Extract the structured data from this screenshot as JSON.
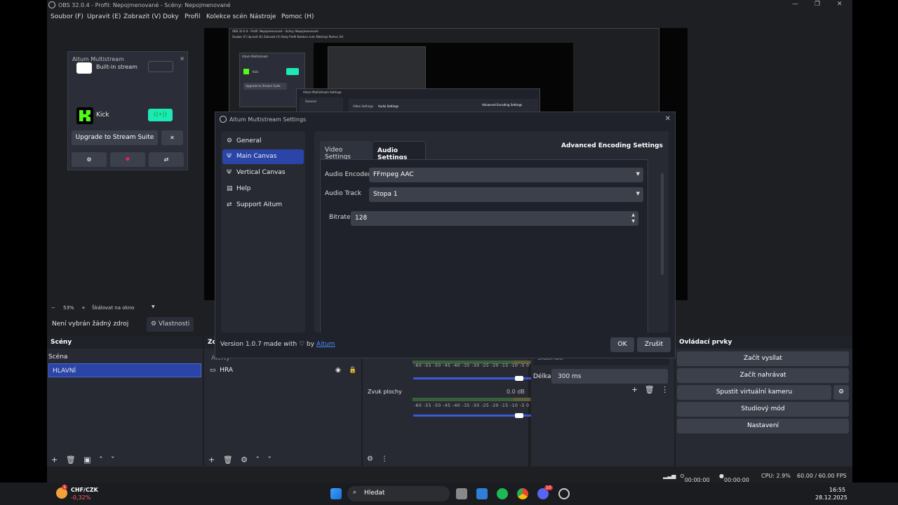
{
  "window": {
    "title": "OBS 32.0.4 - Profil: Nepojmenované - Scény: Nepojmenované",
    "controls": {
      "minimize": "—",
      "maximize": "❐",
      "close": "✕"
    }
  },
  "menu": [
    "Soubor (F)",
    "Upravit (E)",
    "Zobrazit (V)",
    "Doky",
    "Profil",
    "Kolekce scén",
    "Nástroje",
    "Pomoc (H)"
  ],
  "nested": {
    "title": "OBS 32.0.4 - Profil: Nepojmenované - Scény: Nepojmenované",
    "menu": "Soubor (F)   Upravit (E)   Zobrazit (V)   Doky   Profil   Kolekce scén   Nástroje   Pomoc (H)",
    "dock_title": "Aitum Multistream",
    "kick": "Kick",
    "upgrade": "Upgrade to Stream Suite",
    "dialog_title": "Aitum Multistream Settings",
    "general": "General",
    "video_tab": "Video Settings",
    "audio_tab": "Audio Settings",
    "adv": "Advanced Encoding Settings"
  },
  "dock": {
    "title": "Aitum Multistream",
    "close": "×",
    "row1_label": "Built-in stream",
    "row2_label": "Kick",
    "upgrade_label": "Upgrade to Stream Suite",
    "x_label": "✕"
  },
  "zoombar": {
    "minus": "−",
    "zoom": "53%",
    "plus": "+",
    "scale": "Škálovat na okno"
  },
  "srcbar": {
    "no_source": "Není vybrán žádný zdroj",
    "properties": "Vlastnosti"
  },
  "scenes": {
    "title": "Scény",
    "items": [
      "Scéna",
      "HLAVNÍ"
    ]
  },
  "sources": {
    "title": "Zd",
    "items": [
      "Alerty",
      "HRA"
    ]
  },
  "mixer": {
    "ticks": "-60  -55  -50  -45  -40  -35  -30  -25  -20  -15  -10  -5   0",
    "channel2_name": "Zvuk plochy",
    "channel2_level": "0.0 dB"
  },
  "transitions": {
    "fade_label": "Slábnutí",
    "duration_label": "Délka",
    "duration_value": "300 ms"
  },
  "controls": {
    "title": "Ovládací prvky",
    "buttons": [
      "Začít vysílat",
      "Začít nahrávat",
      "Spustit virtuální kameru",
      "Studiový mód",
      "Nastavení"
    ]
  },
  "status": {
    "rec_time1": "00:00:00",
    "rec_time2": "00:00:00",
    "cpu": "CPU: 2.9%",
    "fps": "60.00 / 60.00 FPS"
  },
  "dialog": {
    "title": "Aitum Multistream Settings",
    "close": "✕",
    "sidebar": [
      {
        "label": "General",
        "icon": "gear-icon"
      },
      {
        "label": "Main Canvas",
        "icon": "antenna-icon"
      },
      {
        "label": "Vertical Canvas",
        "icon": "antenna-icon"
      },
      {
        "label": "Help",
        "icon": "document-icon"
      },
      {
        "label": "Support Aitum",
        "icon": "share-icon"
      }
    ],
    "active_item": "Main Canvas",
    "tabs": [
      "Video Settings",
      "Audio Settings"
    ],
    "active_tab": "Audio Settings",
    "advanced_label": "Advanced Encoding Settings",
    "audio_encoder_label": "Audio Encoder",
    "audio_encoder_value": "FFmpeg AAC",
    "audio_track_label": "Audio Track",
    "audio_track_value": "Stopa 1",
    "bitrate_label": "Bitrate",
    "bitrate_value": "128",
    "version_text": "Version 1.0.7 made with ♡ by",
    "version_link": "Aitum",
    "ok": "OK",
    "cancel": "Zrušit"
  },
  "taskbar": {
    "weather_badge": "1",
    "ticker": "CHF/CZK",
    "ticker_change": "-0,32%",
    "search": "Hledat",
    "discord_badge": "10",
    "time": "16:55",
    "date": "28.12.2025"
  },
  "colors": {
    "accent": "#2a44a8",
    "kick_green": "#53fc18",
    "stream_teal": "#1de9b6",
    "link": "#4a8cff"
  }
}
